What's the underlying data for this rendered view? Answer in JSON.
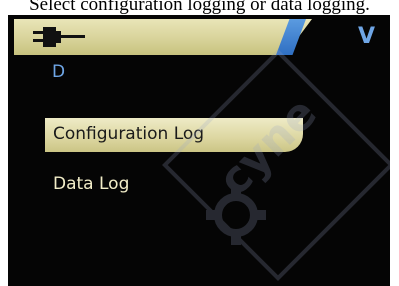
{
  "caption": "Select configuration logging or data logging.",
  "header": {
    "icon": "connector-plug-icon",
    "version_letter": "V",
    "accent_color": "#3f7fd0"
  },
  "sub_label": "D",
  "menu": {
    "items": [
      {
        "label": "Configuration Log",
        "selected": true
      },
      {
        "label": "Data Log",
        "selected": false
      }
    ]
  },
  "watermark": {
    "text": "cyne",
    "icon": "gear-icon"
  }
}
